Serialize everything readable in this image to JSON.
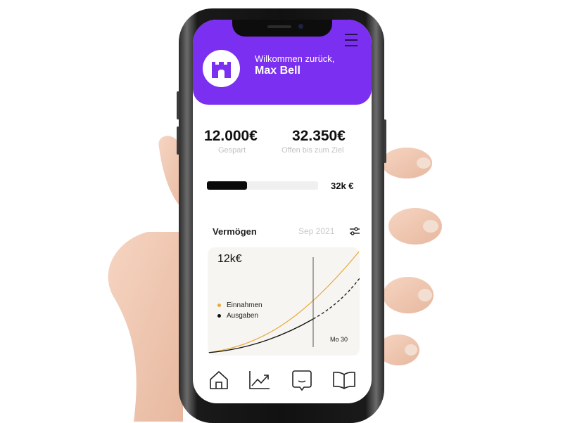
{
  "header": {
    "greeting": "Wilkommen zurück,",
    "user_name": "Max Bell"
  },
  "stats": {
    "saved_value": "12.000€",
    "saved_label": "Gespart",
    "remaining_value": "32.350€",
    "remaining_label": "Offen bis zum Ziel"
  },
  "progress": {
    "fraction": 0.36,
    "label": "32k €"
  },
  "section": {
    "title": "Vermögen",
    "date": "Sep 2021"
  },
  "chart_card": {
    "value": "12k€",
    "legend": [
      {
        "name": "Einnahmen",
        "color": "#e8a93a"
      },
      {
        "name": "Ausgaben",
        "color": "#111111"
      }
    ],
    "marker_label": "Mo 30"
  },
  "chart_data": {
    "type": "line",
    "series": [
      {
        "name": "Einnahmen",
        "color": "#e8a93a",
        "style": "solid"
      },
      {
        "name": "Ausgaben",
        "color": "#111111",
        "style": "solid then dashed after marker"
      }
    ],
    "annotations": [
      "Mo 30"
    ],
    "grid": false,
    "legend_placement": "left"
  },
  "nav": {
    "items": [
      "home-icon",
      "trend-chart-icon",
      "chat-icon",
      "book-icon"
    ]
  },
  "colors": {
    "brand": "#7b2ff0",
    "accent": "#e8a93a",
    "progress": "#0a0a0a"
  }
}
